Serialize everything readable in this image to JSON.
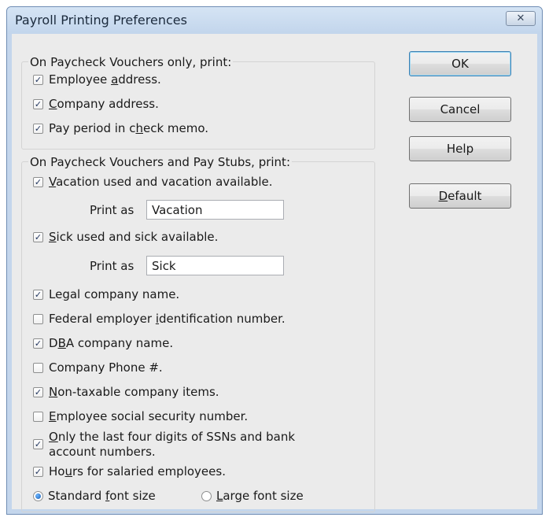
{
  "window": {
    "title": "Payroll Printing Preferences",
    "close_glyph": "✕"
  },
  "vouchers_only_group": {
    "label": "On Paycheck Vouchers only, print:",
    "items": [
      {
        "pre": "Employee ",
        "key": "a",
        "post": "ddress.",
        "checked": true
      },
      {
        "pre": "",
        "key": "C",
        "post": "ompany address.",
        "checked": true
      },
      {
        "pre": "Pay period in c",
        "key": "h",
        "post": "eck memo.",
        "checked": true
      }
    ]
  },
  "vouchers_and_stubs_group": {
    "label": "On Paycheck Vouchers and Pay Stubs, print:",
    "vacation": {
      "pre": "",
      "key": "V",
      "post": "acation used and vacation available.",
      "checked": true
    },
    "vacation_print_as": {
      "label": "Print as",
      "value": "Vacation"
    },
    "sick": {
      "pre": "",
      "key": "S",
      "post": "ick used and sick available.",
      "checked": true
    },
    "sick_print_as": {
      "label": "Print as",
      "value": "Sick"
    },
    "legal_name": {
      "pre": "Le",
      "key": "g",
      "post": "al company name.",
      "checked": true
    },
    "federal_ein": {
      "pre": "Federal employer ",
      "key": "i",
      "post": "dentification number.",
      "checked": false
    },
    "dba_name": {
      "pre": "D",
      "key": "B",
      "post": "A company name.",
      "checked": true
    },
    "company_phone": {
      "pre": "Company Phone #.",
      "key": "",
      "post": "",
      "checked": false
    },
    "non_taxable": {
      "pre": "",
      "key": "N",
      "post": "on-taxable company items.",
      "checked": true
    },
    "employee_ssn": {
      "pre": "",
      "key": "E",
      "post": "mployee social security number.",
      "checked": false
    },
    "last_four": {
      "line1_pre": "",
      "line1_key": "O",
      "line1_post": "nly the last four digits of SSNs and bank",
      "line2": "account numbers.",
      "checked": true
    },
    "hours_salaried": {
      "pre": "Ho",
      "key": "u",
      "post": "rs for salaried employees.",
      "checked": true
    },
    "standard_font": {
      "pre": "Standard ",
      "key": "f",
      "post": "ont size",
      "selected": true
    },
    "large_font": {
      "pre": "",
      "key": "L",
      "post": "arge font size",
      "selected": false
    }
  },
  "buttons": {
    "ok": "OK",
    "cancel": "Cancel",
    "help": "Help",
    "default_key": "D",
    "default_rest": "efault"
  },
  "check_glyph": "✓"
}
